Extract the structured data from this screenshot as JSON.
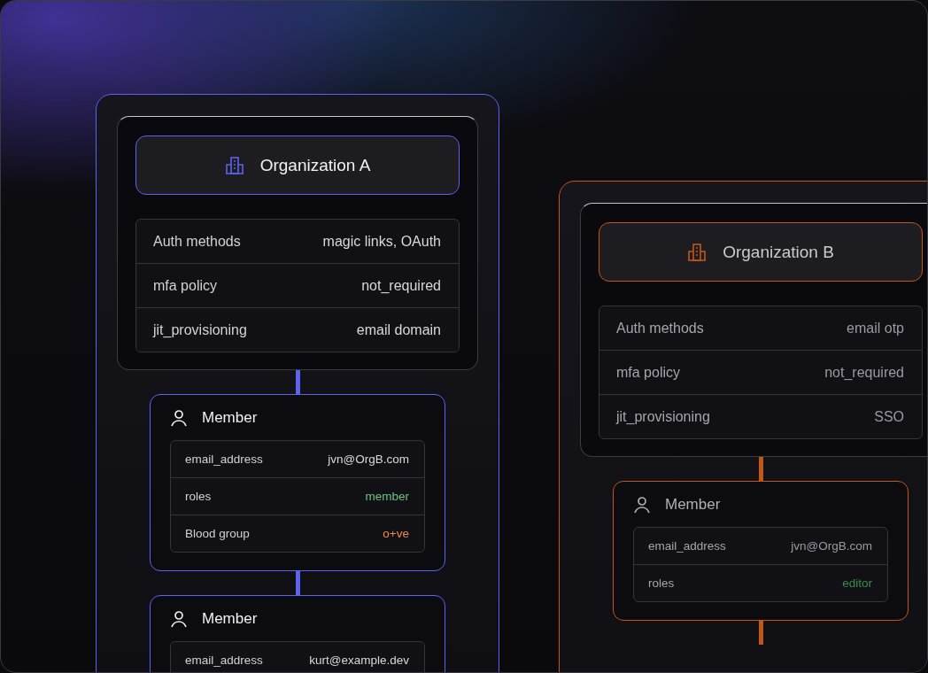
{
  "organizations": [
    {
      "name": "Organization A",
      "color": "#5b63f0",
      "active": true,
      "settings": [
        {
          "label": "Auth methods",
          "value": "magic links, OAuth"
        },
        {
          "label": "mfa policy",
          "value": "not_required"
        },
        {
          "label": "jit_provisioning",
          "value": "email domain"
        }
      ],
      "members": [
        {
          "title": "Member",
          "fields": [
            {
              "label": "email_address",
              "value": "jvn@OrgB.com"
            },
            {
              "label": "roles",
              "value": "member",
              "color": "#6cc383"
            },
            {
              "label": "Blood group",
              "value": "o+ve",
              "color": "#ee8a4c"
            }
          ]
        },
        {
          "title": "Member",
          "fields": [
            {
              "label": "email_address",
              "value": "kurt@example.dev"
            }
          ]
        }
      ]
    },
    {
      "name": "Organization B",
      "color": "#c2571a",
      "active": false,
      "settings": [
        {
          "label": "Auth methods",
          "value": "email otp"
        },
        {
          "label": "mfa policy",
          "value": "not_required"
        },
        {
          "label": "jit_provisioning",
          "value": "SSO"
        }
      ],
      "members": [
        {
          "title": "Member",
          "fields": [
            {
              "label": "email_address",
              "value": "jvn@OrgB.com"
            },
            {
              "label": "roles",
              "value": "editor",
              "color": "#3f8a52"
            }
          ]
        }
      ]
    }
  ]
}
